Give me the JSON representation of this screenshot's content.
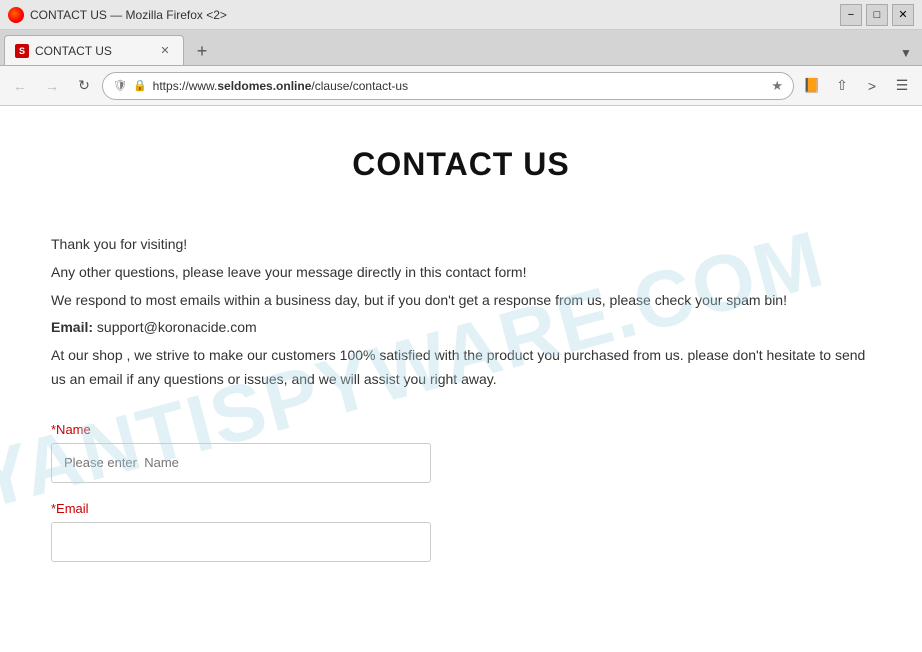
{
  "titlebar": {
    "title": "CONTACT US — Mozilla Firefox <2>",
    "minimize_label": "−",
    "maximize_label": "□",
    "close_label": "✕"
  },
  "tab": {
    "label": "CONTACT US",
    "favicon_letter": "S"
  },
  "navbar": {
    "url_prefix": "https://www.",
    "url_domain": "seldomes.online",
    "url_path": "/clause/contact-us"
  },
  "page": {
    "heading": "CONTACT US",
    "watermark": "MYANTISPYWARE.COM",
    "body": {
      "line1": "Thank you for visiting!",
      "line2": "Any other questions, please leave your message directly in this contact form!",
      "line3": "We respond to most emails within a business day, but if you don't get a response from us, please check your spam bin!",
      "email_label": "Email:",
      "email_value": "support@koronacide.com",
      "line4": "At our shop , we strive to make our customers 100% satisfied with the product you purchased from us. please don't hesitate to send us an email if any questions or issues, and we will assist you right away."
    },
    "form": {
      "name_label": "*Name",
      "name_placeholder": "Please enter  Name",
      "email_label": "*Email",
      "email_placeholder": ""
    }
  }
}
